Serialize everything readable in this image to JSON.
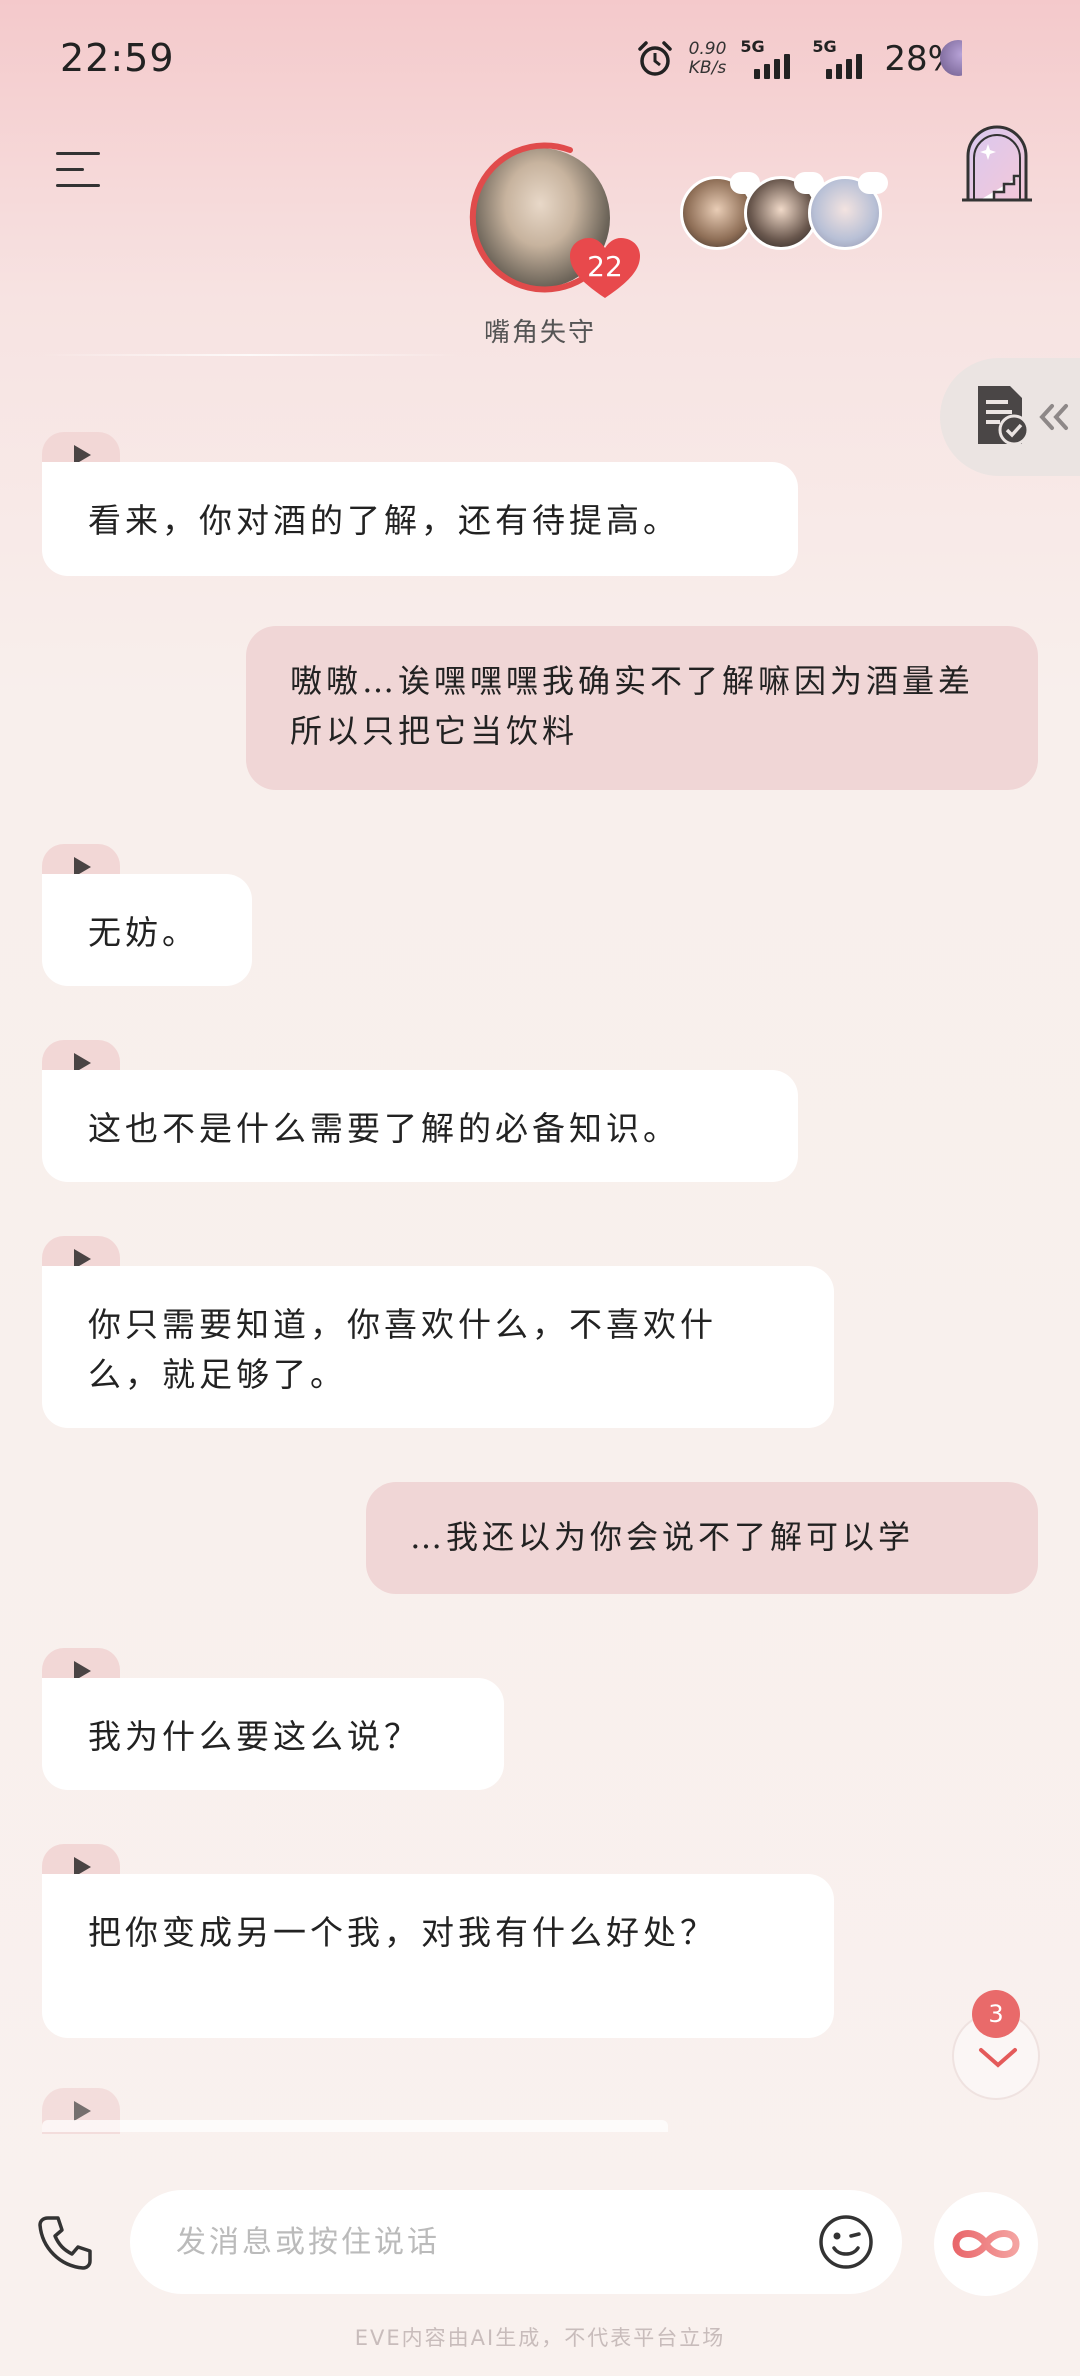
{
  "status_bar": {
    "time": "22:59",
    "net_speed_value": "0.90",
    "net_speed_unit": "KB/s",
    "signal1_label": "5G",
    "signal2_label": "5G",
    "battery": "28%"
  },
  "header": {
    "character_name": "嘴角失守",
    "affinity_level": "22",
    "menu_icon": "hamburger-icon",
    "scene_icon": "stairs-door-icon"
  },
  "messages": [
    {
      "role": "ai",
      "text": "看来，你对酒的了解，还有待提高。"
    },
    {
      "role": "user",
      "text": "嗷嗷…诶嘿嘿嘿我确实不了解嘛因为酒量差所以只把它当饮料"
    },
    {
      "role": "ai",
      "text": "无妨。"
    },
    {
      "role": "ai",
      "text": "这也不是什么需要了解的必备知识。"
    },
    {
      "role": "ai",
      "text": "你只需要知道，你喜欢什么，不喜欢什么，就足够了。"
    },
    {
      "role": "user",
      "text": "…我还以为你会说不了解可以学"
    },
    {
      "role": "ai",
      "text": "我为什么要这么说？"
    },
    {
      "role": "ai",
      "text": "把你变成另一个我，对我有什么好处？"
    }
  ],
  "scroll_down": {
    "unread_count": "3"
  },
  "input_bar": {
    "placeholder": "发消息或按住说话",
    "value": ""
  },
  "disclaimer": "EVE内容由AI生成，不代表平台立场",
  "colors": {
    "accent": "#e96a6a",
    "user_bubble": "#f0d6d6",
    "ai_bubble": "#ffffff"
  }
}
